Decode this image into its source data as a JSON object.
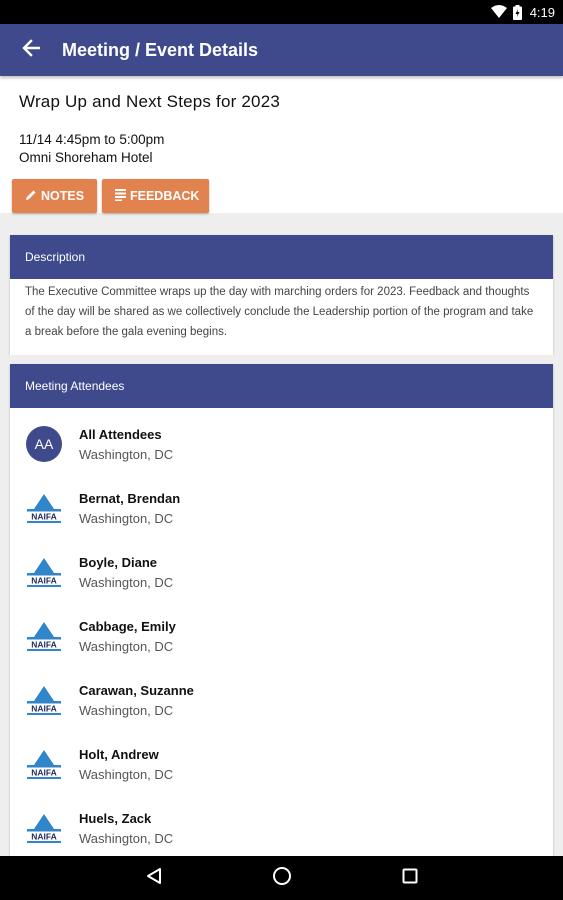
{
  "status_bar": {
    "time": "4:19"
  },
  "app_bar": {
    "title": "Meeting / Event Details"
  },
  "event": {
    "title": "Wrap Up and Next Steps for 2023",
    "time": "11/14 4:45pm to 5:00pm",
    "venue": "Omni Shoreham Hotel"
  },
  "actions": {
    "notes_label": "NOTES",
    "feedback_label": "FEEDBACK"
  },
  "description": {
    "header": "Description",
    "text": "The Executive Committee wraps up the day with marching orders for 2023. Feedback and thoughts of the day will be shared as we collectively conclude the Leadership portion of the program and take a break before the gala evening begins."
  },
  "attendees": {
    "header": "Meeting Attendees",
    "items": [
      {
        "avatar": "AA",
        "name": "All Attendees",
        "location": "Washington, DC"
      },
      {
        "name": "Bernat, Brendan",
        "location": "Washington, DC"
      },
      {
        "name": "Boyle, Diane",
        "location": "Washington, DC"
      },
      {
        "name": "Cabbage, Emily",
        "location": "Washington, DC"
      },
      {
        "name": "Carawan, Suzanne",
        "location": "Washington, DC"
      },
      {
        "name": "Holt, Andrew",
        "location": "Washington, DC"
      },
      {
        "name": "Huels, Zack",
        "location": "Washington, DC"
      }
    ]
  },
  "logo_text": "NAIFA",
  "colors": {
    "primary": "#3f4a8d",
    "accent": "#e2824f",
    "logo_blue": "#2f86c8"
  }
}
